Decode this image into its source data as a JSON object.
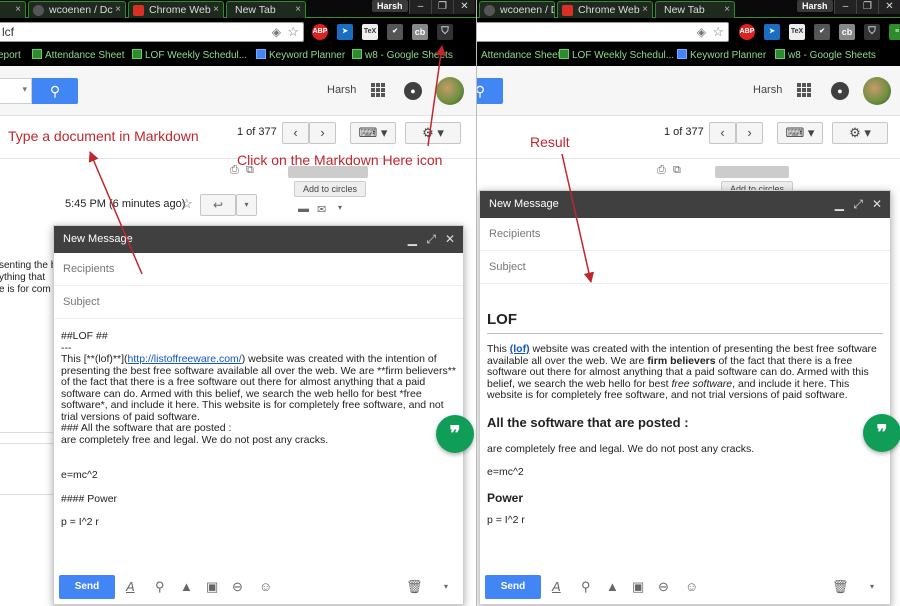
{
  "left": {
    "tabs": [
      {
        "label": "",
        "favicon": "generic"
      },
      {
        "label": "wcoenen / Dc",
        "favicon": "github"
      },
      {
        "label": "Chrome Web",
        "favicon": "webstore"
      },
      {
        "label": "New Tab",
        "favicon": "none"
      }
    ],
    "user_badge": "Harsh",
    "url": "lcf",
    "bookmarks": [
      "eport",
      "Attendance Sheet",
      "LOF Weekly Schedul...",
      "Keyword Planner",
      "w8 - Google Sheets"
    ],
    "username": "Harsh",
    "count_text": "1 of 377",
    "timestamp": "5:45 PM (6 minutes ago)",
    "add_to_circles": "Add to circles",
    "peek_lines": [
      "senting the be",
      "ything that",
      "e is for com"
    ],
    "compose": {
      "title": "New Message",
      "recipients_placeholder": "Recipients",
      "subject_placeholder": "Subject",
      "body": {
        "line1": "##LOF ##",
        "line2": "---",
        "p_start": "This [**(lof)**](",
        "p_link": "http://listoffreeware.com/",
        "p_rest": ") website was created with the intention of presenting the best free software available all over the web. We are **firm believers** of the fact that there is a free software out there for almost anything that a paid software can do. Armed with this belief, we search the web hello for best *free software*, and include it here. This website is for completely free software, and not trial versions of paid software.",
        "h3": "### All the software that are posted :",
        "line_after": "are completely free and legal. We do not post any cracks.",
        "eq": "e=mc^2",
        "h4": "#### Power",
        "power": "p = I^2 r"
      },
      "send_label": "Send"
    },
    "annotation_type": "Type a document in Markdown",
    "annotation_click": "Click on the Markdown Here icon"
  },
  "right": {
    "tabs": [
      {
        "label": "wcoenen / Dc",
        "favicon": "github"
      },
      {
        "label": "Chrome Web",
        "favicon": "webstore"
      },
      {
        "label": "New Tab",
        "favicon": "none"
      }
    ],
    "user_badge": "Harsh",
    "bookmarks": [
      "Attendance Sheet",
      "LOF Weekly Schedul...",
      "Keyword Planner",
      "w8 - Google Sheets"
    ],
    "username": "Harsh",
    "count_text": "1 of 377",
    "add_to_circles": "Add to circles",
    "compose": {
      "title": "New Message",
      "recipients_placeholder": "Recipients",
      "subject_placeholder": "Subject",
      "body": {
        "h2": "LOF",
        "p_start": "This ",
        "p_link": "(lof)",
        "p_mid1": " website was created with the intention of presenting the best free software available all over the web. We are ",
        "p_bold": "firm believers",
        "p_mid2": " of the fact that there is a free software out there for almost anything that a paid software can do. Armed with this belief, we search the web hello for best ",
        "p_italic": "free software",
        "p_end": ", and include it here. This website is for completely free software, and not trial versions of paid software.",
        "h3": "All the software that are posted :",
        "line_after": "are completely free and legal. We do not post any cracks.",
        "eq": "e=mc^2",
        "h4": "Power",
        "power": "p = I^2 r"
      },
      "send_label": "Send"
    },
    "annotation_result": "Result"
  },
  "extension_icons": [
    "abp-icon",
    "arrow-extension-icon",
    "tex-icon",
    "checkmark-extension-icon",
    "cb-icon",
    "markdown-here-icon"
  ],
  "colors": {
    "gmail_blue": "#4285f4",
    "annotation_red": "#c0272d",
    "compose_header": "#404040",
    "hangouts_green": "#0f9d58"
  }
}
